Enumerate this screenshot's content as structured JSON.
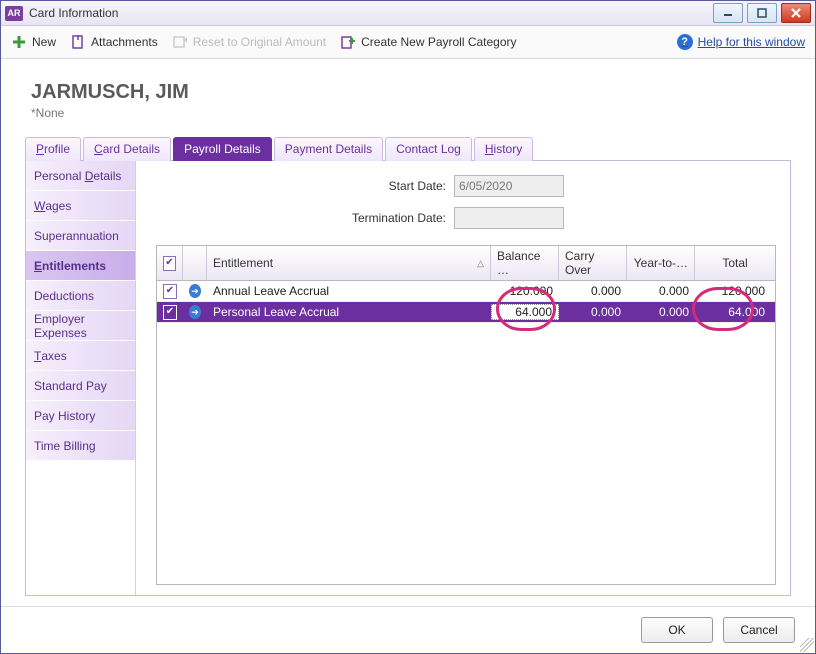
{
  "window": {
    "app_badge": "AR",
    "title": "Card Information"
  },
  "toolbar": {
    "new": "New",
    "attachments": "Attachments",
    "reset": "Reset to Original Amount",
    "create_category": "Create New Payroll Category",
    "help": "Help for this window"
  },
  "page": {
    "title": "JARMUSCH, JIM",
    "subtitle": "*None"
  },
  "top_tabs": [
    {
      "key": "profile",
      "label": "Profile",
      "ukey": "P"
    },
    {
      "key": "card",
      "label": "Card Details",
      "ukey": "C"
    },
    {
      "key": "payroll",
      "label": "Payroll Details",
      "ukey": ""
    },
    {
      "key": "payment",
      "label": "Payment Details",
      "ukey": ""
    },
    {
      "key": "contact",
      "label": "Contact Log",
      "ukey": ""
    },
    {
      "key": "history",
      "label": "History",
      "ukey": "H"
    }
  ],
  "active_top_tab": "payroll",
  "sub_tabs": [
    {
      "key": "personal",
      "label": "Personal Details",
      "u": "D"
    },
    {
      "key": "wages",
      "label": "Wages",
      "u": "W"
    },
    {
      "key": "super",
      "label": "Superannuation",
      "u": ""
    },
    {
      "key": "entitle",
      "label": "Entitlements",
      "u": "E"
    },
    {
      "key": "deduct",
      "label": "Deductions",
      "u": ""
    },
    {
      "key": "empexp",
      "label": "Employer Expenses",
      "u": ""
    },
    {
      "key": "taxes",
      "label": "Taxes",
      "u": "T"
    },
    {
      "key": "stdpay",
      "label": "Standard Pay",
      "u": ""
    },
    {
      "key": "payhist",
      "label": "Pay History",
      "u": ""
    },
    {
      "key": "timebill",
      "label": "Time Billing",
      "u": ""
    }
  ],
  "active_sub_tab": "entitle",
  "fields": {
    "start_date_label": "Start Date:",
    "start_date_value": "6/05/2020",
    "term_date_label": "Termination Date:",
    "term_date_value": ""
  },
  "grid": {
    "headers": {
      "entitlement": "Entitlement",
      "balance": "Balance …",
      "carry": "Carry Over",
      "ytd": "Year-to-…",
      "total": "Total"
    },
    "rows": [
      {
        "checked": true,
        "name": "Annual Leave Accrual",
        "balance": "120.000",
        "carry": "0.000",
        "ytd": "0.000",
        "total": "120.000",
        "selected": false,
        "highlight": false
      },
      {
        "checked": true,
        "name": "Personal Leave Accrual",
        "balance": "64.000",
        "carry": "0.000",
        "ytd": "0.000",
        "total": "64.000",
        "selected": true,
        "highlight": true
      }
    ]
  },
  "footer": {
    "ok": "OK",
    "cancel": "Cancel"
  }
}
